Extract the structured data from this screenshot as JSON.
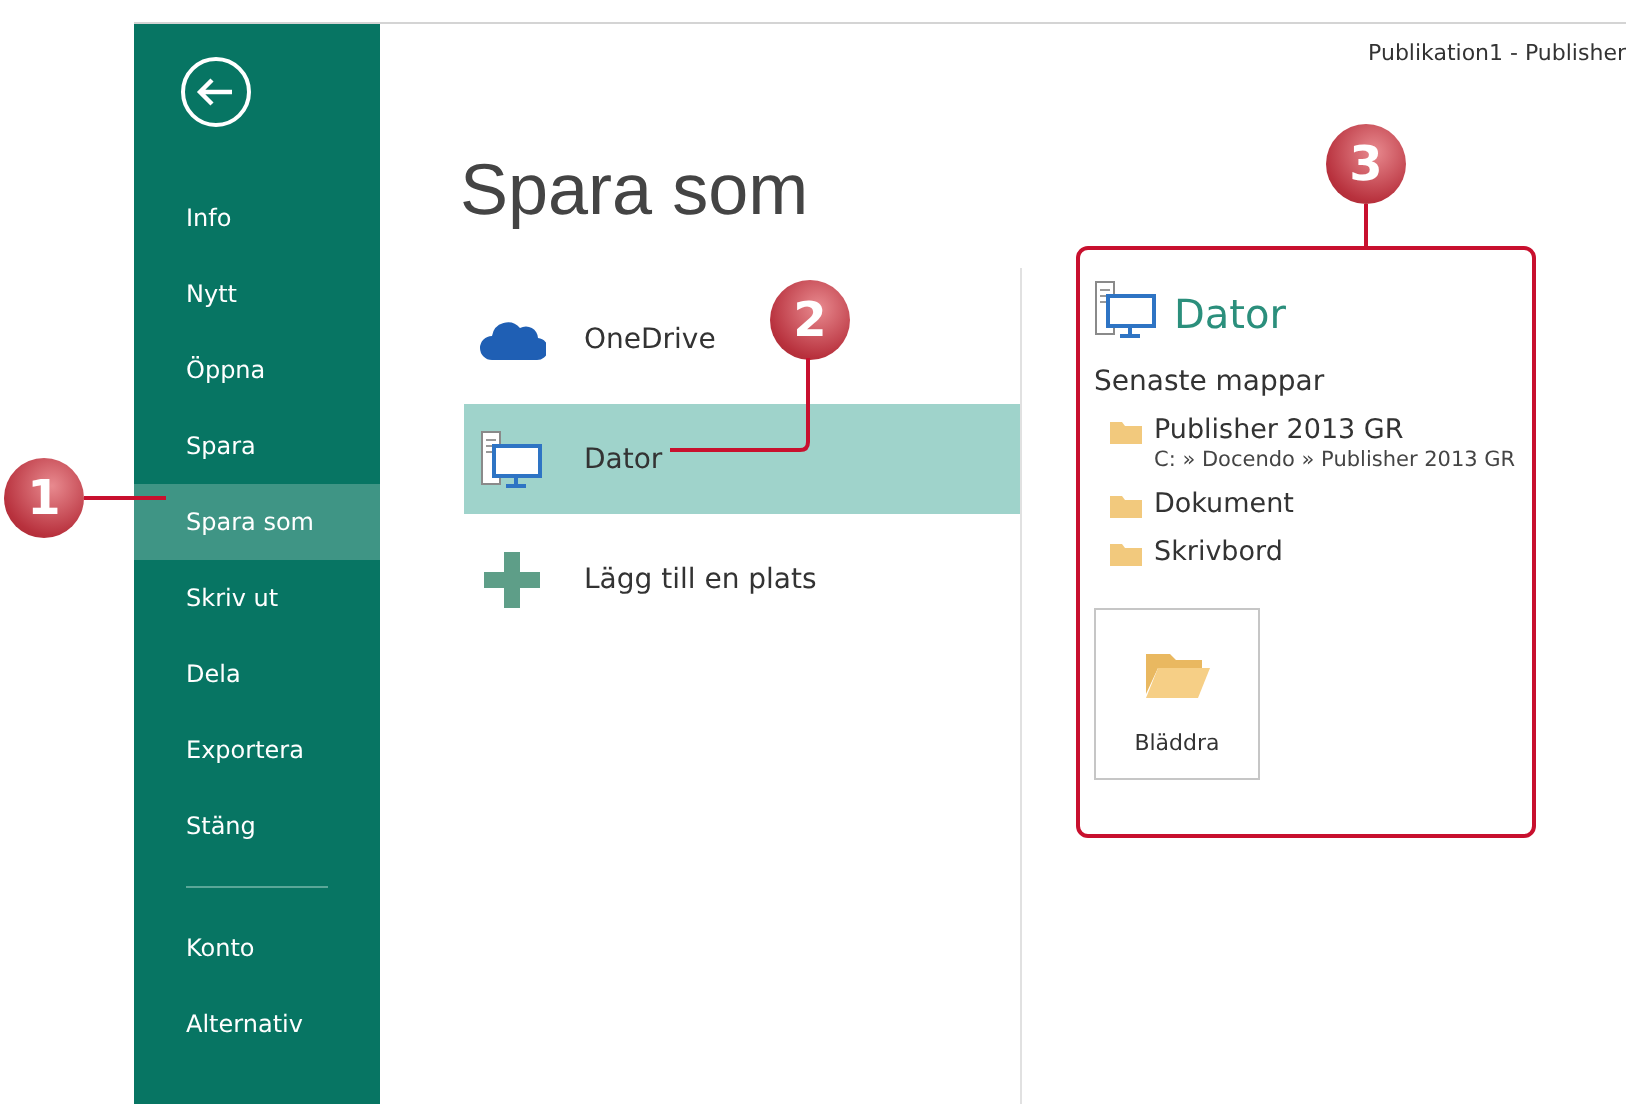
{
  "window": {
    "title": "Publikation1 - Publisher"
  },
  "sidebar": {
    "items": [
      {
        "label": "Info",
        "selected": false
      },
      {
        "label": "Nytt",
        "selected": false
      },
      {
        "label": "Öppna",
        "selected": false
      },
      {
        "label": "Spara",
        "selected": false
      },
      {
        "label": "Spara som",
        "selected": true
      },
      {
        "label": "Skriv ut",
        "selected": false
      },
      {
        "label": "Dela",
        "selected": false
      },
      {
        "label": "Exportera",
        "selected": false
      },
      {
        "label": "Stäng",
        "selected": false
      },
      {
        "label": "Konto",
        "selected": false,
        "kind": "separated"
      },
      {
        "label": "Alternativ",
        "selected": false
      }
    ]
  },
  "heading": "Spara som",
  "places": [
    {
      "label": "OneDrive",
      "selected": false,
      "kind": "cloud"
    },
    {
      "label": "Dator",
      "selected": true,
      "kind": "computer"
    },
    {
      "label": "Lägg till en plats",
      "selected": false,
      "kind": "add"
    }
  ],
  "panel": {
    "title": "Dator",
    "recent_heading": "Senaste mappar",
    "folders": [
      {
        "name": "Publisher 2013 GR",
        "path": "C: » Docendo » Publisher 2013 GR"
      },
      {
        "name": "Dokument"
      },
      {
        "name": "Skrivbord"
      }
    ],
    "browse_button": "Bläddra"
  },
  "callouts": [
    {
      "number": "1"
    },
    {
      "number": "2"
    },
    {
      "number": "3"
    }
  ]
}
